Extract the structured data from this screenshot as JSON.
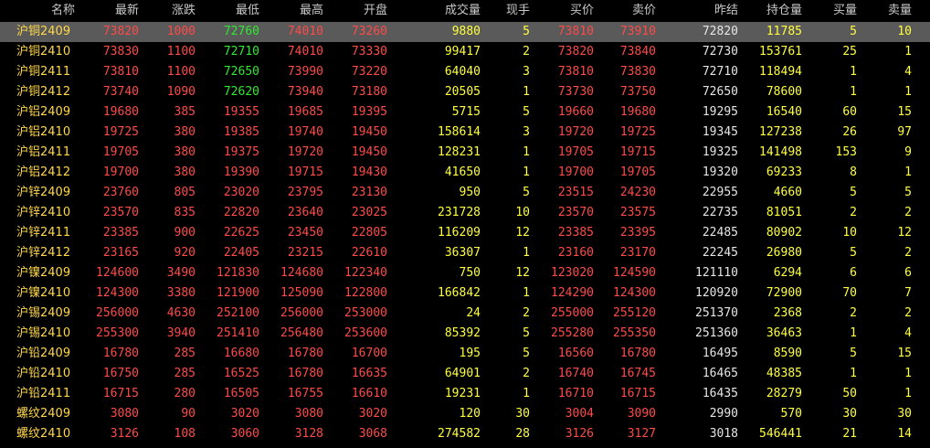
{
  "colors": {
    "up": "#ff4a4a",
    "down": "#2fea2f",
    "volume": "#ffff3c",
    "neutral": "#e6e6e6",
    "name": "#ffd84a",
    "selected_row_bg": "#5a5a5a"
  },
  "headers": [
    "名称",
    "最新",
    "涨跌",
    "最低",
    "最高",
    "开盘",
    "成交量",
    "现手",
    "买价",
    "卖价",
    "昨结",
    "持仓量",
    "买量",
    "卖量"
  ],
  "rows": [
    {
      "name": "沪铜2409",
      "last": "73820",
      "chg": "1000",
      "low": "72760",
      "high": "74010",
      "open": "73260",
      "vol": "9880",
      "cur": "5",
      "bid": "73810",
      "ask": "73910",
      "prev": "72820",
      "oi": "11785",
      "bidv": "5",
      "askv": "10",
      "low_dir": "down",
      "open_dir": "up"
    },
    {
      "name": "沪铜2410",
      "last": "73830",
      "chg": "1100",
      "low": "72710",
      "high": "74010",
      "open": "73330",
      "vol": "99417",
      "cur": "2",
      "bid": "73820",
      "ask": "73840",
      "prev": "72730",
      "oi": "153761",
      "bidv": "25",
      "askv": "1",
      "low_dir": "down",
      "open_dir": "up"
    },
    {
      "name": "沪铜2411",
      "last": "73810",
      "chg": "1100",
      "low": "72650",
      "high": "73990",
      "open": "73220",
      "vol": "64040",
      "cur": "3",
      "bid": "73810",
      "ask": "73830",
      "prev": "72710",
      "oi": "118494",
      "bidv": "1",
      "askv": "4",
      "low_dir": "down",
      "open_dir": "up"
    },
    {
      "name": "沪铜2412",
      "last": "73740",
      "chg": "1090",
      "low": "72620",
      "high": "73940",
      "open": "73180",
      "vol": "20505",
      "cur": "1",
      "bid": "73730",
      "ask": "73750",
      "prev": "72650",
      "oi": "78600",
      "bidv": "1",
      "askv": "1",
      "low_dir": "down",
      "open_dir": "up"
    },
    {
      "name": "沪铝2409",
      "last": "19680",
      "chg": "385",
      "low": "19355",
      "high": "19685",
      "open": "19395",
      "vol": "5715",
      "cur": "5",
      "bid": "19660",
      "ask": "19680",
      "prev": "19295",
      "oi": "16540",
      "bidv": "60",
      "askv": "15",
      "low_dir": "up",
      "open_dir": "up"
    },
    {
      "name": "沪铝2410",
      "last": "19725",
      "chg": "380",
      "low": "19385",
      "high": "19740",
      "open": "19450",
      "vol": "158614",
      "cur": "3",
      "bid": "19720",
      "ask": "19725",
      "prev": "19345",
      "oi": "127238",
      "bidv": "26",
      "askv": "97",
      "low_dir": "up",
      "open_dir": "up"
    },
    {
      "name": "沪铝2411",
      "last": "19705",
      "chg": "380",
      "low": "19375",
      "high": "19720",
      "open": "19450",
      "vol": "128231",
      "cur": "1",
      "bid": "19705",
      "ask": "19715",
      "prev": "19325",
      "oi": "141498",
      "bidv": "153",
      "askv": "9",
      "low_dir": "up",
      "open_dir": "up"
    },
    {
      "name": "沪铝2412",
      "last": "19700",
      "chg": "380",
      "low": "19390",
      "high": "19715",
      "open": "19430",
      "vol": "41650",
      "cur": "1",
      "bid": "19700",
      "ask": "19705",
      "prev": "19320",
      "oi": "69233",
      "bidv": "8",
      "askv": "1",
      "low_dir": "up",
      "open_dir": "up"
    },
    {
      "name": "沪锌2409",
      "last": "23760",
      "chg": "805",
      "low": "23020",
      "high": "23795",
      "open": "23130",
      "vol": "950",
      "cur": "5",
      "bid": "23515",
      "ask": "24230",
      "prev": "22955",
      "oi": "4660",
      "bidv": "5",
      "askv": "5",
      "low_dir": "up",
      "open_dir": "up"
    },
    {
      "name": "沪锌2410",
      "last": "23570",
      "chg": "835",
      "low": "22820",
      "high": "23640",
      "open": "23025",
      "vol": "231728",
      "cur": "10",
      "bid": "23570",
      "ask": "23575",
      "prev": "22735",
      "oi": "81051",
      "bidv": "2",
      "askv": "2",
      "low_dir": "up",
      "open_dir": "up"
    },
    {
      "name": "沪锌2411",
      "last": "23385",
      "chg": "900",
      "low": "22625",
      "high": "23450",
      "open": "22805",
      "vol": "116209",
      "cur": "12",
      "bid": "23385",
      "ask": "23395",
      "prev": "22485",
      "oi": "80902",
      "bidv": "10",
      "askv": "12",
      "low_dir": "up",
      "open_dir": "up"
    },
    {
      "name": "沪锌2412",
      "last": "23165",
      "chg": "920",
      "low": "22405",
      "high": "23215",
      "open": "22610",
      "vol": "36307",
      "cur": "1",
      "bid": "23160",
      "ask": "23170",
      "prev": "22245",
      "oi": "26980",
      "bidv": "5",
      "askv": "2",
      "low_dir": "up",
      "open_dir": "up"
    },
    {
      "name": "沪镍2409",
      "last": "124600",
      "chg": "3490",
      "low": "121830",
      "high": "124680",
      "open": "122340",
      "vol": "750",
      "cur": "12",
      "bid": "123020",
      "ask": "124590",
      "prev": "121110",
      "oi": "6294",
      "bidv": "6",
      "askv": "6",
      "low_dir": "up",
      "open_dir": "up"
    },
    {
      "name": "沪镍2410",
      "last": "124300",
      "chg": "3380",
      "low": "121900",
      "high": "125090",
      "open": "122800",
      "vol": "166842",
      "cur": "1",
      "bid": "124290",
      "ask": "124300",
      "prev": "120920",
      "oi": "72900",
      "bidv": "70",
      "askv": "7",
      "low_dir": "up",
      "open_dir": "up"
    },
    {
      "name": "沪锡2409",
      "last": "256000",
      "chg": "4630",
      "low": "252100",
      "high": "256000",
      "open": "253000",
      "vol": "24",
      "cur": "2",
      "bid": "255000",
      "ask": "255120",
      "prev": "251370",
      "oi": "2368",
      "bidv": "2",
      "askv": "2",
      "low_dir": "up",
      "open_dir": "up"
    },
    {
      "name": "沪锡2410",
      "last": "255300",
      "chg": "3940",
      "low": "251410",
      "high": "256480",
      "open": "253600",
      "vol": "85392",
      "cur": "5",
      "bid": "255280",
      "ask": "255350",
      "prev": "251360",
      "oi": "36463",
      "bidv": "1",
      "askv": "4",
      "low_dir": "up",
      "open_dir": "up"
    },
    {
      "name": "沪铅2409",
      "last": "16780",
      "chg": "285",
      "low": "16680",
      "high": "16780",
      "open": "16700",
      "vol": "195",
      "cur": "5",
      "bid": "16560",
      "ask": "16780",
      "prev": "16495",
      "oi": "8590",
      "bidv": "5",
      "askv": "15",
      "low_dir": "up",
      "open_dir": "up"
    },
    {
      "name": "沪铅2410",
      "last": "16750",
      "chg": "285",
      "low": "16525",
      "high": "16780",
      "open": "16635",
      "vol": "64901",
      "cur": "2",
      "bid": "16740",
      "ask": "16745",
      "prev": "16465",
      "oi": "48385",
      "bidv": "1",
      "askv": "1",
      "low_dir": "up",
      "open_dir": "up"
    },
    {
      "name": "沪铅2411",
      "last": "16715",
      "chg": "280",
      "low": "16505",
      "high": "16755",
      "open": "16610",
      "vol": "19231",
      "cur": "1",
      "bid": "16710",
      "ask": "16715",
      "prev": "16435",
      "oi": "28279",
      "bidv": "50",
      "askv": "1",
      "low_dir": "up",
      "open_dir": "up"
    },
    {
      "name": "螺纹2409",
      "last": "3080",
      "chg": "90",
      "low": "3020",
      "high": "3080",
      "open": "3020",
      "vol": "120",
      "cur": "30",
      "bid": "3004",
      "ask": "3090",
      "prev": "2990",
      "oi": "570",
      "bidv": "30",
      "askv": "30",
      "low_dir": "up",
      "open_dir": "up"
    },
    {
      "name": "螺纹2410",
      "last": "3126",
      "chg": "108",
      "low": "3060",
      "high": "3128",
      "open": "3068",
      "vol": "274582",
      "cur": "28",
      "bid": "3126",
      "ask": "3127",
      "prev": "3018",
      "oi": "546441",
      "bidv": "21",
      "askv": "14",
      "low_dir": "up",
      "open_dir": "up"
    }
  ]
}
